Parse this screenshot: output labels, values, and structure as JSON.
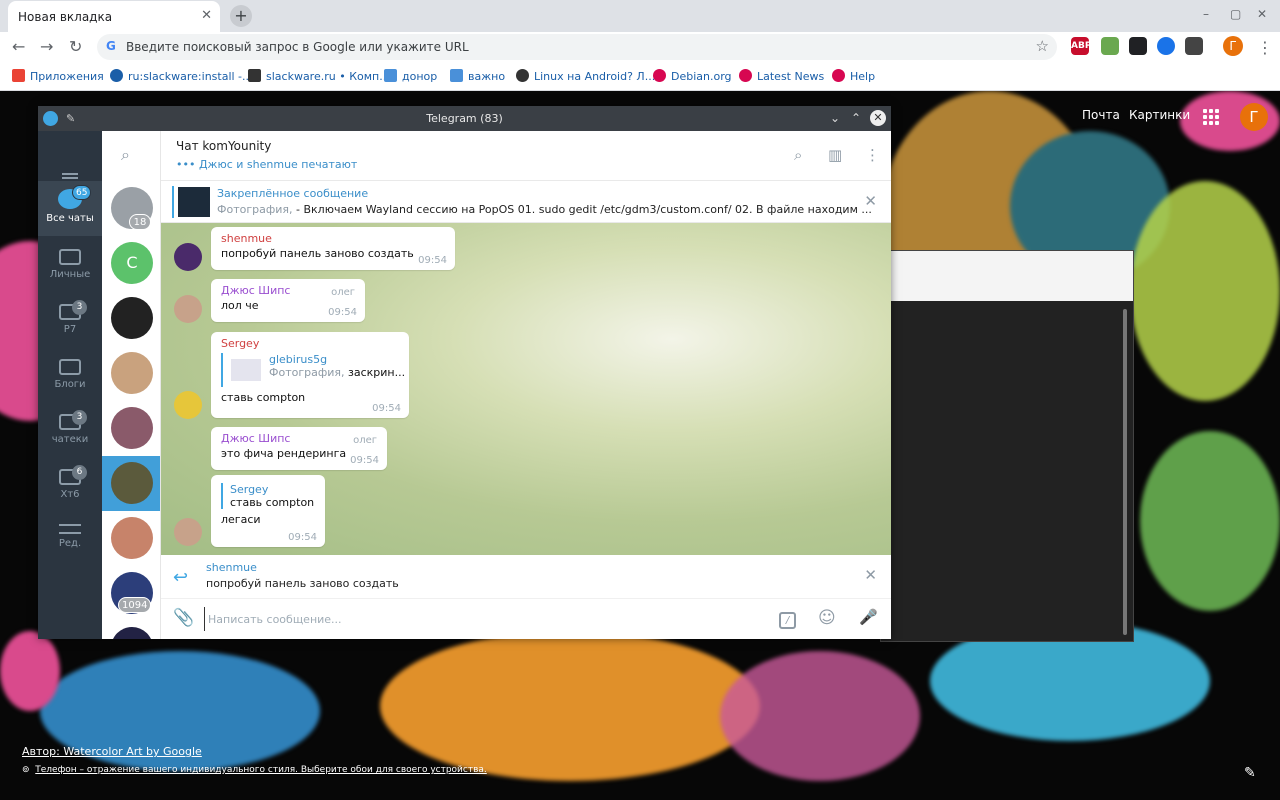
{
  "browser": {
    "tab_title": "Новая вкладка",
    "tab_close": "✕",
    "new_tab": "+",
    "window_controls": [
      "–",
      "▢",
      "✕"
    ],
    "nav": {
      "back": "←",
      "forward": "→",
      "reload": "↻"
    },
    "omnibox_placeholder": "Введите поисковый запрос в Google или укажите URL",
    "omnibox_g": "G",
    "star": "☆",
    "extensions": [
      {
        "label": "ABP",
        "color": "#c70d2c"
      },
      {
        "label": "",
        "color": "#6aa84f"
      },
      {
        "label": "",
        "color": "#202124"
      },
      {
        "label": "",
        "color": "#1a73e8"
      },
      {
        "label": "",
        "color": "#444444"
      }
    ],
    "profile_initial": "Г",
    "menu": "⋮",
    "bookmarks": [
      {
        "label": "Приложения",
        "color": "#ea4335"
      },
      {
        "label": "ru:slackware:install -...",
        "color": "#1a5ea8"
      },
      {
        "label": "slackware.ru • Комп...",
        "color": "#333333"
      },
      {
        "label": "донор",
        "color": "#4a90d9"
      },
      {
        "label": "важно",
        "color": "#4a90d9"
      },
      {
        "label": "Linux на Android? Л...",
        "color": "#333333"
      },
      {
        "label": "Debian.org",
        "color": "#d70751"
      },
      {
        "label": "Latest News",
        "color": "#d70751"
      },
      {
        "label": "Help",
        "color": "#d70751"
      }
    ]
  },
  "google": {
    "mail": "Почта",
    "images": "Картинки",
    "profile_initial": "Г",
    "credit": "Автор: Watercolor Art by Google",
    "promo": "Телефон – отражение вашего индивидуального стиля. Выберите обои для своего устройства.",
    "edit_icon": "✎"
  },
  "telegram": {
    "window_title": "Telegram (83)",
    "folders": [
      {
        "label": "Все чаты",
        "badge": "65",
        "active": true
      },
      {
        "label": "Личные",
        "badge": ""
      },
      {
        "label": "P7",
        "badge": "3"
      },
      {
        "label": "Блоги",
        "badge": ""
      },
      {
        "label": "чатеки",
        "badge": "3"
      },
      {
        "label": "Хт6",
        "badge": "6"
      },
      {
        "label": "Ред.",
        "badge": ""
      }
    ],
    "chat_avatars": [
      {
        "badge": "18",
        "color": "#9aa0a6",
        "letter": ""
      },
      {
        "badge": "",
        "color": "#5cc26b",
        "letter": "C"
      },
      {
        "badge": "",
        "color": "#222222",
        "letter": ""
      },
      {
        "badge": "",
        "color": "#c9a27e",
        "letter": ""
      },
      {
        "badge": "",
        "color": "#8a5a6a",
        "letter": ""
      },
      {
        "badge": "",
        "color": "#5b5a3c",
        "letter": "",
        "selected": true
      },
      {
        "badge": "",
        "color": "#c7836a",
        "letter": ""
      },
      {
        "badge": "1094",
        "color": "#2c3e7a",
        "letter": ""
      },
      {
        "badge": "",
        "color": "#222244",
        "letter": ""
      }
    ],
    "chat_name": "Чат komYounity",
    "typing": "••• Джюс и shenmue печатают",
    "pinned": {
      "title": "Закреплённое сообщение",
      "prefix": "Фотография,",
      "text": " - Включаем Wayland сессию на PopOS  01. sudo gedit /etc/gdm3/custom.conf/ 02. В файле находим ..."
    },
    "messages": [
      {
        "from": "shenmue",
        "text": "попробуй панель заново создать",
        "time": "09:54"
      },
      {
        "from": "Джюс Шипс",
        "role": "олег",
        "text": "лол че",
        "time": "09:54"
      },
      {
        "from": "Sergey",
        "reply_name": "glebirus5g",
        "reply_prefix": "Фотография,",
        "reply_text": " заскрин...",
        "text": "ставь compton",
        "time": "09:54"
      },
      {
        "from": "Джюс Шипс",
        "role": "олег",
        "text": "это фича рендеринга",
        "time": "09:54"
      },
      {
        "reply_name": "Sergey",
        "reply_text": "ставь compton",
        "text": "легаси",
        "time": "09:54"
      }
    ],
    "reply_bar": {
      "name": "shenmue",
      "text": "попробуй панель заново создать"
    },
    "compose_placeholder": "Написать сообщение...",
    "icons": {
      "search": "⌕",
      "close": "✕",
      "reply": "↩",
      "attach": "📎",
      "emoji": "☺",
      "mic": "🎤",
      "cmd": "/",
      "sidebar": "▥",
      "more": "⋮"
    }
  }
}
